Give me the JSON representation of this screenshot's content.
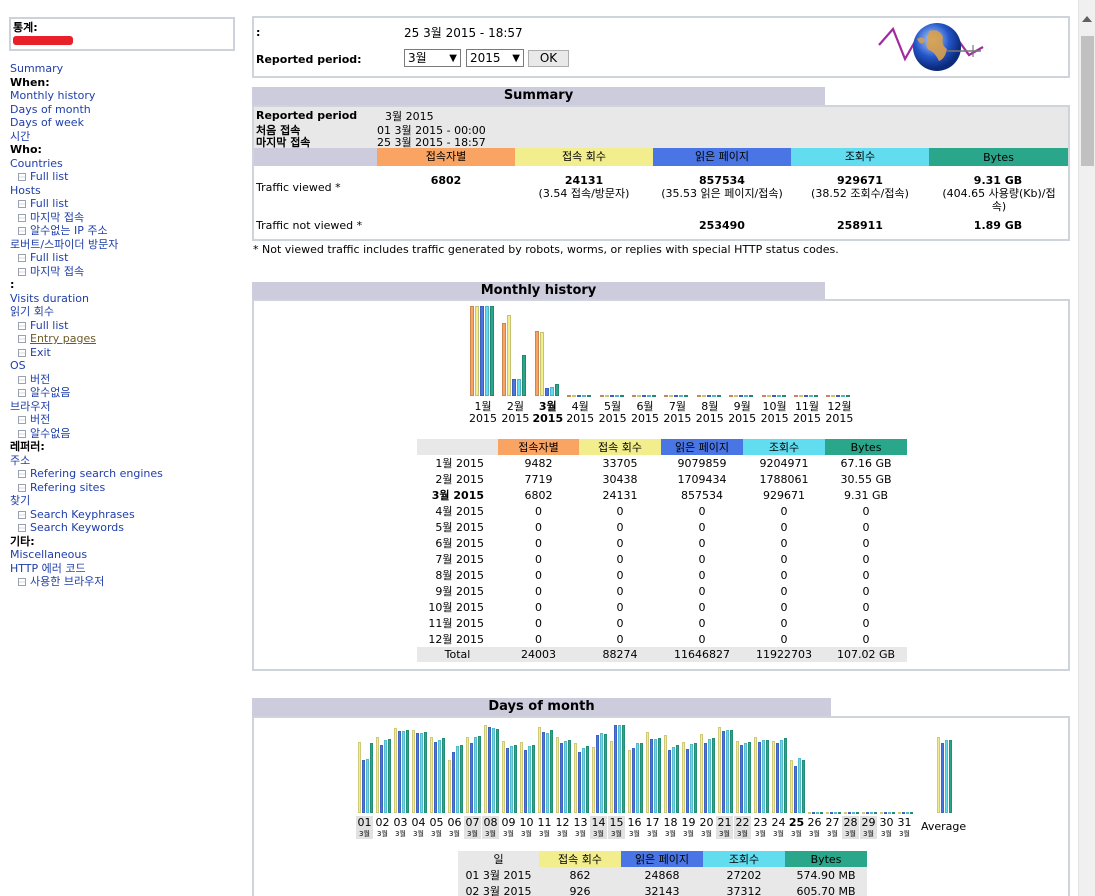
{
  "nav": {
    "stat_label": "통계:",
    "items": [
      {
        "type": "link",
        "text": "Summary"
      },
      {
        "type": "head",
        "text": "When:"
      },
      {
        "type": "link",
        "text": "Monthly history"
      },
      {
        "type": "link",
        "text": "Days of month"
      },
      {
        "type": "link",
        "text": "Days of week"
      },
      {
        "type": "plain",
        "text": "시간"
      },
      {
        "type": "head",
        "text": "Who:"
      },
      {
        "type": "link",
        "text": "Countries"
      },
      {
        "type": "sub",
        "text": "Full list"
      },
      {
        "type": "link",
        "text": "Hosts"
      },
      {
        "type": "sub",
        "text": "Full list"
      },
      {
        "type": "sub",
        "text": "마지막 접속"
      },
      {
        "type": "sub",
        "text": "알수없는 IP 주소"
      },
      {
        "type": "link",
        "text": "로버트/스파이더 방문자"
      },
      {
        "type": "sub",
        "text": "Full list"
      },
      {
        "type": "sub",
        "text": "마지막 접속"
      },
      {
        "type": "head",
        "text": ":"
      },
      {
        "type": "link",
        "text": "Visits duration"
      },
      {
        "type": "link",
        "text": "읽기 회수"
      },
      {
        "type": "sub",
        "text": "Full list"
      },
      {
        "type": "subv",
        "text": "Entry pages"
      },
      {
        "type": "sub",
        "text": "Exit"
      },
      {
        "type": "link",
        "text": "OS"
      },
      {
        "type": "sub",
        "text": "버전"
      },
      {
        "type": "sub",
        "text": "알수없음"
      },
      {
        "type": "link",
        "text": "브라우저"
      },
      {
        "type": "sub",
        "text": "버전"
      },
      {
        "type": "sub",
        "text": "알수없음"
      },
      {
        "type": "head",
        "text": "레퍼러:"
      },
      {
        "type": "link",
        "text": "주소"
      },
      {
        "type": "sub",
        "text": "Refering search engines"
      },
      {
        "type": "sub",
        "text": "Refering sites"
      },
      {
        "type": "link",
        "text": "찾기"
      },
      {
        "type": "sub",
        "text": "Search Keyphrases"
      },
      {
        "type": "sub",
        "text": "Search Keywords"
      },
      {
        "type": "head",
        "text": "기타:"
      },
      {
        "type": "link",
        "text": "Miscellaneous"
      },
      {
        "type": "link",
        "text": "HTTP 에러 코드"
      },
      {
        "type": "sub",
        "text": "사용한 브라우저"
      }
    ]
  },
  "top": {
    "colon": ":",
    "date": "25 3월 2015 - 18:57",
    "period_label": "Reported period:",
    "month_value": "3월",
    "year_value": "2015",
    "ok_label": "OK"
  },
  "summary": {
    "title": "Summary",
    "period_label": "Reported period",
    "period_value": "3월 2015",
    "first_label": "처음 접속",
    "first_value": "01 3월 2015 - 00:00",
    "last_label": "마지막 접속",
    "last_value": "25 3월 2015 - 18:57",
    "headers": [
      "접속자별",
      "접속 회수",
      "읽은 페이지",
      "조회수",
      "Bytes"
    ],
    "viewed_label": "Traffic viewed *",
    "viewed": [
      "6802",
      "24131",
      "857534",
      "929671",
      "9.31 GB"
    ],
    "viewed_sub": [
      "",
      "(3.54 접속/방문자)",
      "(35.53 읽은 페이지/접속)",
      "(38.52 조회수/접속)",
      "(404.65 사용량(Kb)/접속)"
    ],
    "notviewed_label": "Traffic not viewed *",
    "notviewed": [
      "",
      "",
      "253490",
      "258911",
      "1.89 GB"
    ],
    "footnote": "* Not viewed traffic includes traffic generated by robots, worms, or replies with special HTTP status codes."
  },
  "monthly": {
    "title": "Monthly history",
    "month_labels": [
      "1월",
      "2월",
      "3월",
      "4월",
      "5월",
      "6월",
      "7월",
      "8월",
      "9월",
      "10월",
      "11월",
      "12월"
    ],
    "year_label": "2015",
    "headers": [
      "접속자별",
      "접속 회수",
      "읽은 페이지",
      "조회수",
      "Bytes"
    ],
    "rows": [
      {
        "m": "1월 2015",
        "v": "9482",
        "s": "33705",
        "p": "9079859",
        "h": "9204971",
        "b": "67.16 GB"
      },
      {
        "m": "2월 2015",
        "v": "7719",
        "s": "30438",
        "p": "1709434",
        "h": "1788061",
        "b": "30.55 GB"
      },
      {
        "m": "3월 2015",
        "v": "6802",
        "s": "24131",
        "p": "857534",
        "h": "929671",
        "b": "9.31 GB"
      },
      {
        "m": "4월 2015",
        "v": "0",
        "s": "0",
        "p": "0",
        "h": "0",
        "b": "0"
      },
      {
        "m": "5월 2015",
        "v": "0",
        "s": "0",
        "p": "0",
        "h": "0",
        "b": "0"
      },
      {
        "m": "6월 2015",
        "v": "0",
        "s": "0",
        "p": "0",
        "h": "0",
        "b": "0"
      },
      {
        "m": "7월 2015",
        "v": "0",
        "s": "0",
        "p": "0",
        "h": "0",
        "b": "0"
      },
      {
        "m": "8월 2015",
        "v": "0",
        "s": "0",
        "p": "0",
        "h": "0",
        "b": "0"
      },
      {
        "m": "9월 2015",
        "v": "0",
        "s": "0",
        "p": "0",
        "h": "0",
        "b": "0"
      },
      {
        "m": "10월 2015",
        "v": "0",
        "s": "0",
        "p": "0",
        "h": "0",
        "b": "0"
      },
      {
        "m": "11월 2015",
        "v": "0",
        "s": "0",
        "p": "0",
        "h": "0",
        "b": "0"
      },
      {
        "m": "12월 2015",
        "v": "0",
        "s": "0",
        "p": "0",
        "h": "0",
        "b": "0"
      }
    ],
    "total": {
      "m": "Total",
      "v": "24003",
      "s": "88274",
      "p": "11646827",
      "h": "11922703",
      "b": "107.02 GB"
    }
  },
  "days": {
    "title": "Days of month",
    "day_labels": [
      "01",
      "02",
      "03",
      "04",
      "05",
      "06",
      "07",
      "08",
      "09",
      "10",
      "11",
      "12",
      "13",
      "14",
      "15",
      "16",
      "17",
      "18",
      "19",
      "20",
      "21",
      "22",
      "23",
      "24",
      "25",
      "26",
      "27",
      "28",
      "29",
      "30",
      "31"
    ],
    "sub_label": "3월",
    "average_label": "Average",
    "headers": [
      "일",
      "접속 회수",
      "읽은 페이지",
      "조회수",
      "Bytes"
    ],
    "rows": [
      {
        "d": "01 3월 2015",
        "s": "862",
        "p": "24868",
        "h": "27202",
        "b": "574.90 MB"
      },
      {
        "d": "02 3월 2015",
        "s": "926",
        "p": "32143",
        "h": "37312",
        "b": "605.70 MB"
      }
    ]
  },
  "chart_data": [
    {
      "type": "bar",
      "title": "Monthly history",
      "categories": [
        "1월 2015",
        "2월 2015",
        "3월 2015",
        "4월 2015",
        "5월 2015",
        "6월 2015",
        "7월 2015",
        "8월 2015",
        "9월 2015",
        "10월 2015",
        "11월 2015",
        "12월 2015"
      ],
      "series": [
        {
          "name": "접속자별",
          "values": [
            9482,
            7719,
            6802,
            0,
            0,
            0,
            0,
            0,
            0,
            0,
            0,
            0
          ]
        },
        {
          "name": "접속 회수",
          "values": [
            33705,
            30438,
            24131,
            0,
            0,
            0,
            0,
            0,
            0,
            0,
            0,
            0
          ]
        },
        {
          "name": "읽은 페이지",
          "values": [
            9079859,
            1709434,
            857534,
            0,
            0,
            0,
            0,
            0,
            0,
            0,
            0,
            0
          ]
        },
        {
          "name": "조회수",
          "values": [
            9204971,
            1788061,
            929671,
            0,
            0,
            0,
            0,
            0,
            0,
            0,
            0,
            0
          ]
        },
        {
          "name": "Bytes",
          "values": [
            67.16,
            30.55,
            9.31,
            0,
            0,
            0,
            0,
            0,
            0,
            0,
            0,
            0
          ]
        }
      ],
      "colors": [
        "#f9a463",
        "#f2ee8e",
        "#4a75e4",
        "#62dcef",
        "#2aa78a"
      ]
    },
    {
      "type": "bar",
      "title": "Days of month",
      "categories": [
        "01",
        "02",
        "03",
        "04",
        "05",
        "06",
        "07",
        "08",
        "09",
        "10",
        "11",
        "12",
        "13",
        "14",
        "15",
        "16",
        "17",
        "18",
        "19",
        "20",
        "21",
        "22",
        "23",
        "24",
        "25",
        "26",
        "27",
        "28",
        "29",
        "30",
        "31",
        "Average"
      ],
      "series": [
        {
          "name": "접속 회수",
          "values": [
            862,
            926,
            1030,
            1010,
            930,
            650,
            920,
            1070,
            880,
            860,
            1050,
            920,
            850,
            800,
            880,
            760,
            990,
            950,
            860,
            960,
            1050,
            880,
            930,
            880,
            640,
            0,
            0,
            0,
            0,
            0,
            0,
            920
          ]
        },
        {
          "name": "읽은 페이지",
          "values": [
            24868,
            32143,
            38800,
            37500,
            33500,
            28900,
            33000,
            40400,
            30500,
            29500,
            38000,
            33000,
            28800,
            36800,
            41500,
            30600,
            34800,
            29800,
            30200,
            33200,
            38700,
            32100,
            33400,
            32800,
            22000,
            0,
            0,
            0,
            0,
            0,
            0,
            33000
          ]
        },
        {
          "name": "조회수",
          "values": [
            27202,
            37312,
            41700,
            40700,
            37200,
            34000,
            38400,
            43200,
            34200,
            34000,
            40700,
            36500,
            33100,
            40600,
            44700,
            35400,
            37700,
            33600,
            35000,
            37700,
            42300,
            35500,
            37000,
            37000,
            27800,
            0,
            0,
            0,
            0,
            0,
            0,
            37000
          ]
        },
        {
          "name": "Bytes",
          "values": [
            574.9,
            605.7,
            680,
            660,
            610,
            560,
            630,
            690,
            560,
            560,
            680,
            600,
            550,
            650,
            720,
            570,
            610,
            560,
            570,
            610,
            680,
            580,
            600,
            610,
            430,
            0,
            0,
            0,
            0,
            0,
            0,
            600
          ]
        }
      ],
      "colors": [
        "#f2ee8e",
        "#4a75e4",
        "#62dcef",
        "#2aa78a"
      ]
    }
  ]
}
